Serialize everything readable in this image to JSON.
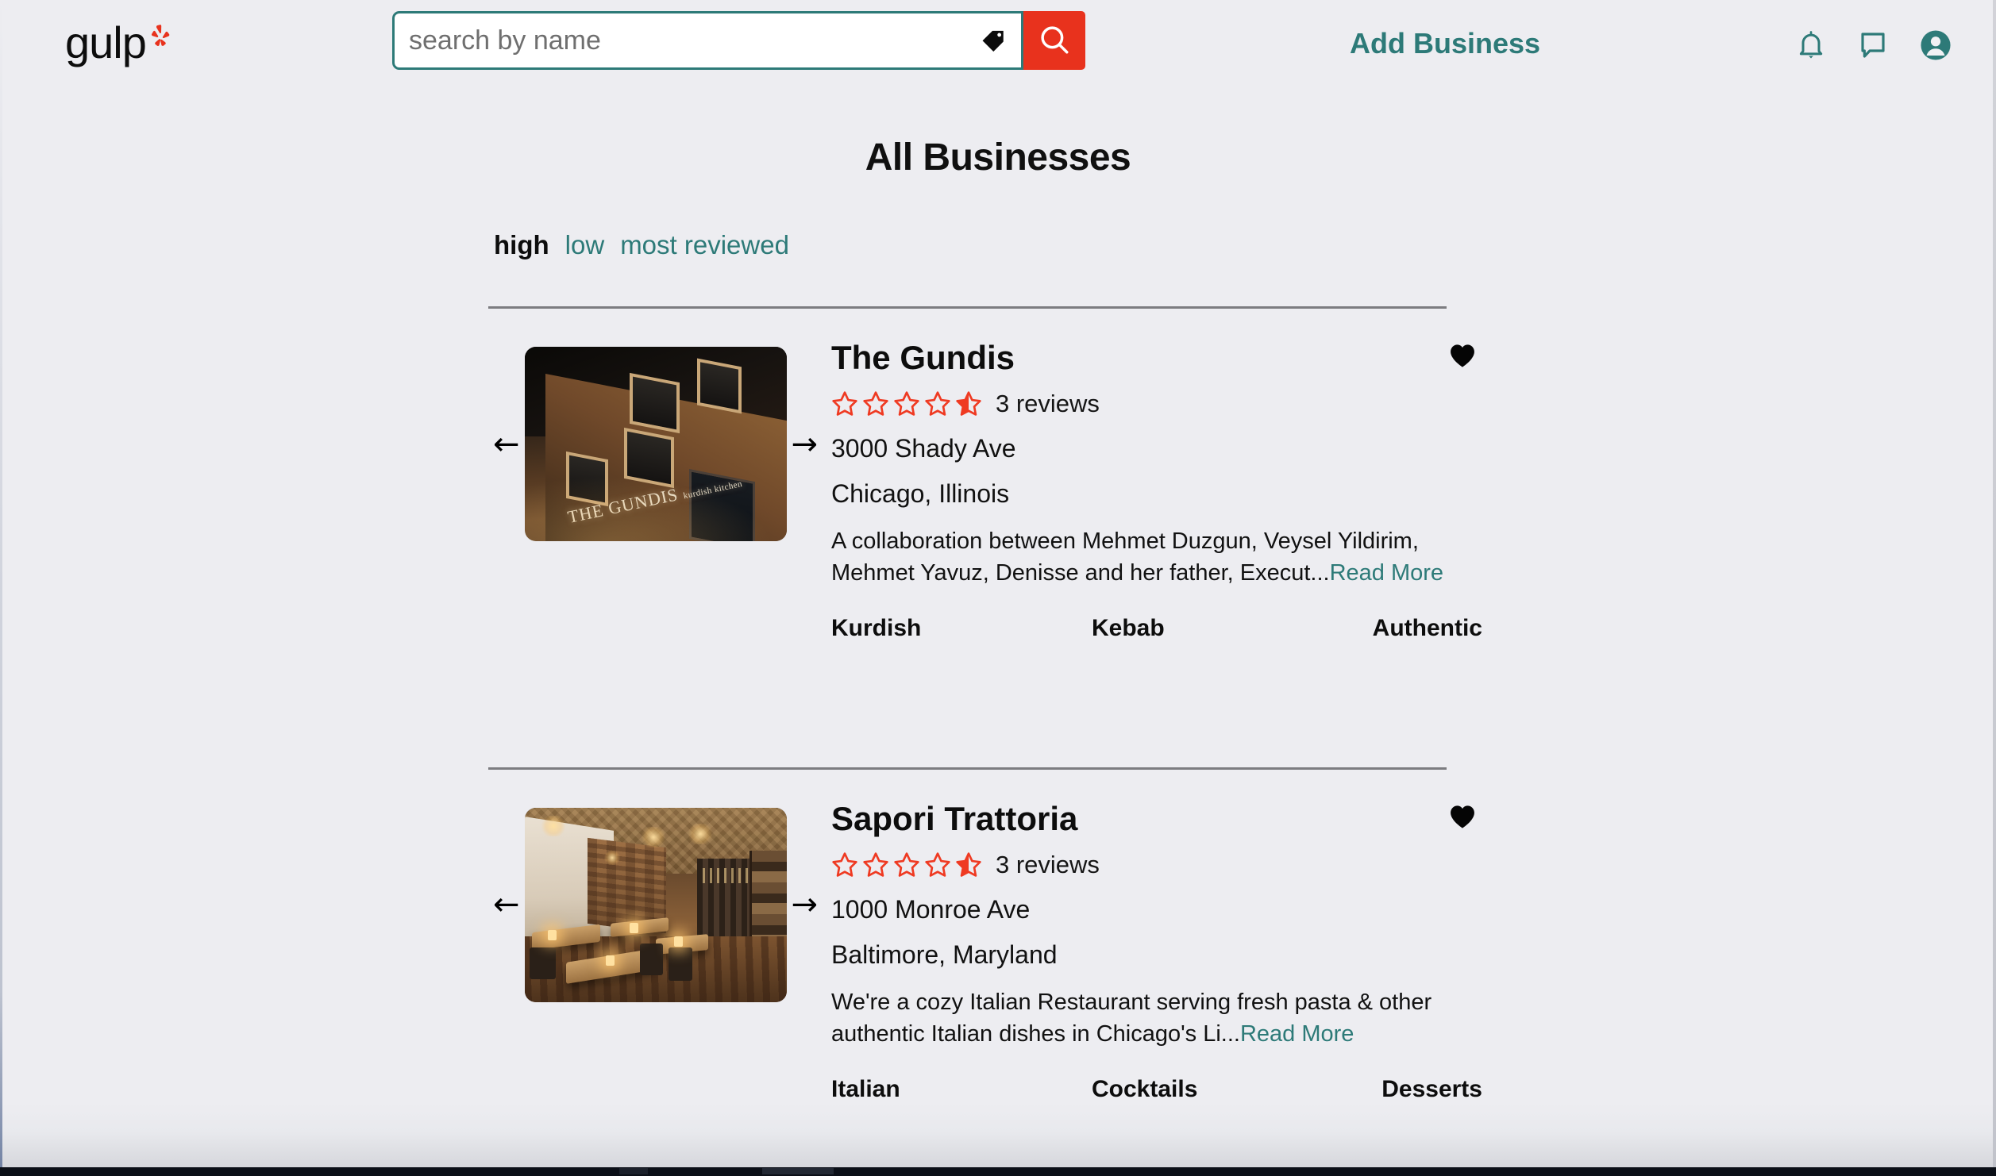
{
  "brand": {
    "name": "gulp",
    "burst_color": "#e8321d",
    "accent_teal": "#2d7a78"
  },
  "header": {
    "search": {
      "placeholder": "search by name",
      "value": "",
      "tag_icon": "price-tag-icon",
      "search_icon": "magnifying-glass-icon"
    },
    "add_business_label": "Add Business",
    "icons": [
      {
        "name": "notifications-bell-icon"
      },
      {
        "name": "messages-chat-icon"
      },
      {
        "name": "account-avatar-icon"
      }
    ]
  },
  "main": {
    "title": "All Businesses",
    "sorts": [
      {
        "label": "high",
        "active": true
      },
      {
        "label": "low",
        "active": false
      },
      {
        "label": "most reviewed",
        "active": false
      }
    ],
    "read_more_label": "Read More",
    "businesses": [
      {
        "name": "The Gundis",
        "rating_stars": 4.5,
        "review_count": "3 reviews",
        "street": "3000 Shady Ave",
        "city_state": "Chicago, Illinois",
        "description": "A collaboration between Mehmet Duzgun, Veysel Yildirim, Mehmet Yavuz, Denisse and her father, Execut...",
        "tags": [
          "Kurdish",
          "Kebab",
          "Authentic"
        ],
        "favorite": true,
        "photo_alt": "night exterior of The Gundis kurdish kitchen brick building",
        "photo_sign_main": "THE GUNDIS",
        "photo_sign_sub": "kurdish kitchen"
      },
      {
        "name": "Sapori Trattoria",
        "rating_stars": 4.5,
        "review_count": "3 reviews",
        "street": "1000 Monroe Ave",
        "city_state": "Baltimore, Maryland",
        "description": "We're a cozy Italian Restaurant serving fresh pasta & other authentic Italian dishes in Chicago's Li...",
        "tags": [
          "Italian",
          "Cocktails",
          "Desserts"
        ],
        "favorite": true,
        "photo_alt": "warm candle-lit Italian restaurant dining room with chandeliers"
      }
    ]
  }
}
